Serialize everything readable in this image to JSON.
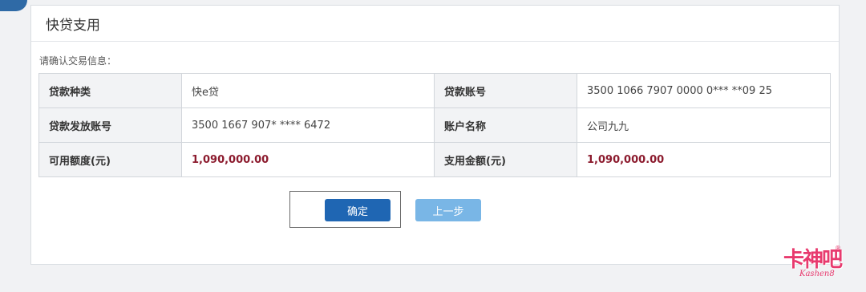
{
  "header": {
    "title": "快贷支用"
  },
  "confirm_prompt": "请确认交易信息：",
  "info_table": {
    "rows": [
      {
        "label_left": "贷款种类",
        "value_left": "快e贷",
        "label_right": "贷款账号",
        "value_right": "3500 1066 7907 0000 0*** **09 25"
      },
      {
        "label_left": "贷款发放账号",
        "value_left": "3500 1667 907* **** 6472",
        "label_right": "账户名称",
        "value_right": "公司九九"
      },
      {
        "label_left": "可用额度(元)",
        "value_left": "1,090,000.00",
        "label_right": "支用金额(元)",
        "value_right": "1,090,000.00"
      }
    ]
  },
  "buttons": {
    "confirm": "确定",
    "previous": "上一步"
  },
  "watermark": {
    "main": "卡神吧",
    "sub": "Kashen8",
    "reg": "®"
  },
  "colors": {
    "primary_button": "#1f66b3",
    "secondary_button": "#79b6e6",
    "amount_text": "#8c1b2e",
    "watermark": "#e83a6e"
  }
}
